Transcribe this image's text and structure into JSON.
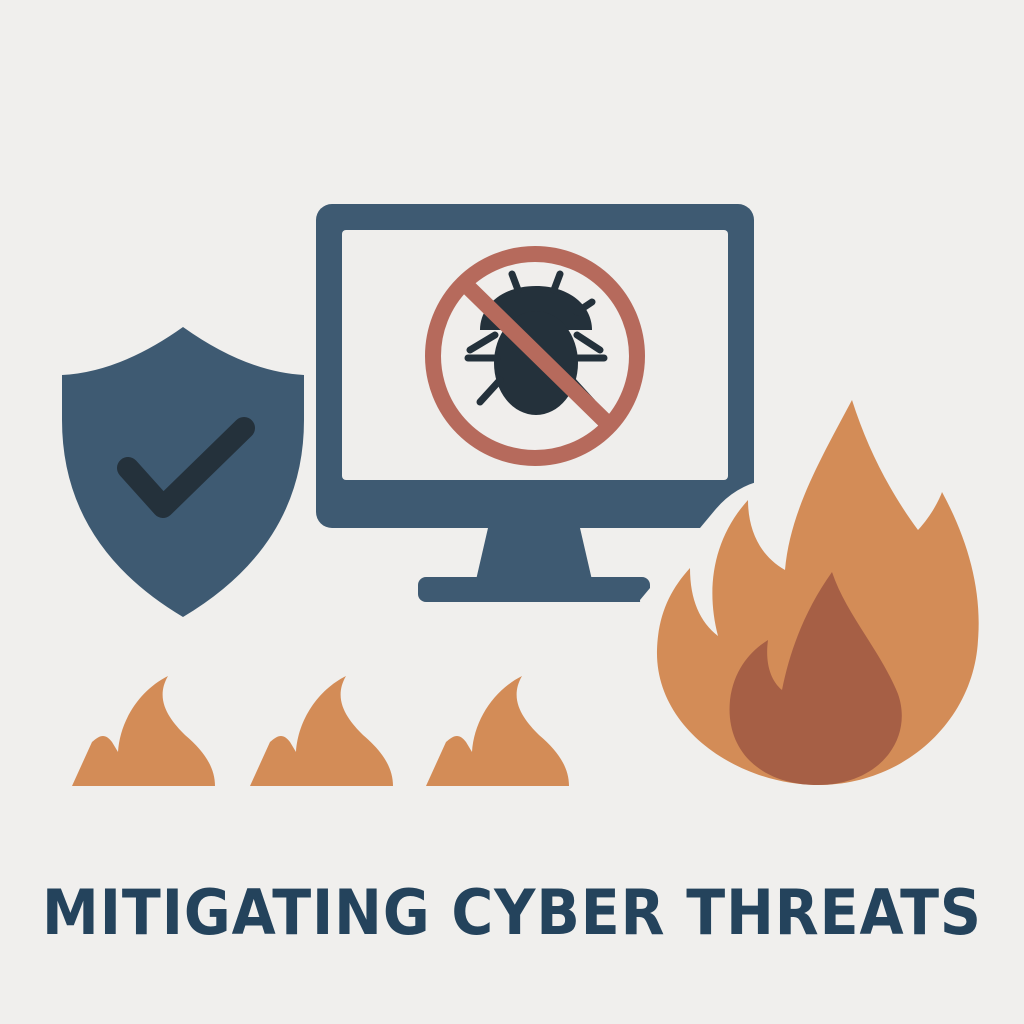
{
  "headline": "MITIGATING CYBER THREATS",
  "colors": {
    "background": "#f0efed",
    "navy": "#3e5a72",
    "dark": "#24313b",
    "warning_red": "#b66a5c",
    "flame_orange": "#d38c57",
    "flame_inner": "#a65f45",
    "screen": "#efeeec"
  },
  "icons": {
    "shield": "shield-check-icon",
    "monitor": "monitor-icon",
    "bug": "bug-icon",
    "no_symbol": "prohibited-icon",
    "fire": "fire-icon",
    "small_flames": "small-flame-icon"
  }
}
